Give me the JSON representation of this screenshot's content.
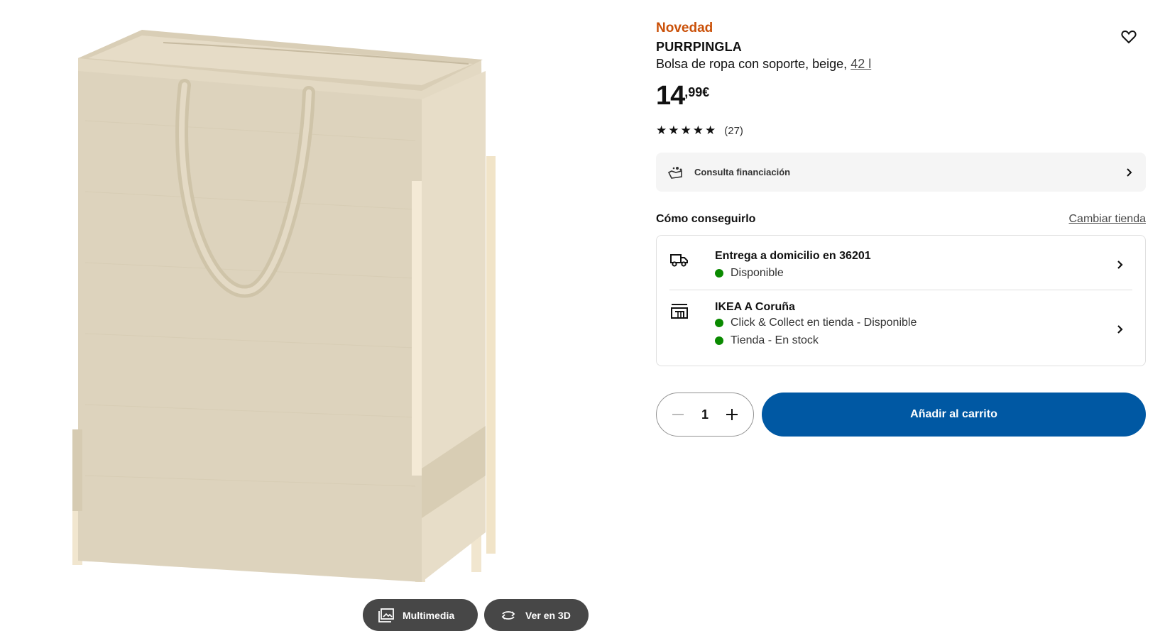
{
  "media": {
    "multimedia_label": "Multimedia",
    "view3d_label": "Ver en 3D"
  },
  "product": {
    "badge": "Novedad",
    "name": "PURRPINGLA",
    "description": "Bolsa de ropa con soporte, beige, ",
    "size_link": "42 l",
    "price_integer": "14",
    "price_decimal": ",99€",
    "rating_value": 5,
    "rating_count": "(27)"
  },
  "finance": {
    "label": "Consulta financiación"
  },
  "availability": {
    "title": "Cómo conseguirlo",
    "change_store": "Cambiar tienda",
    "delivery": {
      "title": "Entrega a domicilio en 36201",
      "status": "Disponible"
    },
    "store": {
      "title": "IKEA A Coruña",
      "click_collect": "Click & Collect en tienda - Disponible",
      "in_store": "Tienda - En stock"
    },
    "status_color": "#0a8a00"
  },
  "purchase": {
    "quantity": "1",
    "add_to_cart": "Añadir al carrito",
    "button_color": "#0058a3"
  },
  "colors": {
    "badge": "#ca5008",
    "product_fabric": "#ddd3bd"
  }
}
